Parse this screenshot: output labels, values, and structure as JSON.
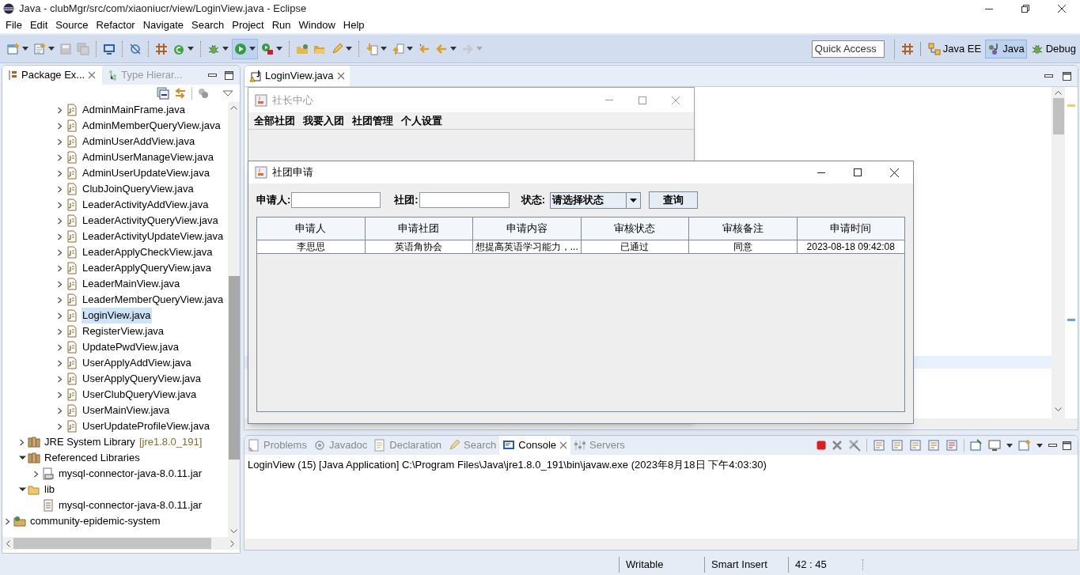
{
  "window": {
    "title": "Java - clubMgr/src/com/xiaoniucr/view/LoginView.java - Eclipse"
  },
  "menu": [
    "File",
    "Edit",
    "Source",
    "Refactor",
    "Navigate",
    "Search",
    "Project",
    "Run",
    "Window",
    "Help"
  ],
  "quick_access": {
    "placeholder": "Quick Access"
  },
  "perspectives": [
    {
      "label": "Java EE",
      "selected": false
    },
    {
      "label": "Java",
      "selected": true
    },
    {
      "label": "Debug",
      "selected": false
    }
  ],
  "package_explorer": {
    "tabs": [
      {
        "label": "Package Ex...",
        "selected": true
      },
      {
        "label": "Type Hierar...",
        "selected": false
      }
    ],
    "files": [
      {
        "label": "AdminMainFrame.java",
        "selected": false
      },
      {
        "label": "AdminMemberQueryView.java",
        "selected": false
      },
      {
        "label": "AdminUserAddView.java",
        "selected": false
      },
      {
        "label": "AdminUserManageView.java",
        "selected": false
      },
      {
        "label": "AdminUserUpdateView.java",
        "selected": false
      },
      {
        "label": "ClubJoinQueryView.java",
        "selected": false
      },
      {
        "label": "LeaderActivityAddView.java",
        "selected": false
      },
      {
        "label": "LeaderActivityQueryView.java",
        "selected": false
      },
      {
        "label": "LeaderActivityUpdateView.java",
        "selected": false
      },
      {
        "label": "LeaderApplyCheckView.java",
        "selected": false
      },
      {
        "label": "LeaderApplyQueryView.java",
        "selected": false
      },
      {
        "label": "LeaderMainView.java",
        "selected": false
      },
      {
        "label": "LeaderMemberQueryView.java",
        "selected": false
      },
      {
        "label": "LoginView.java",
        "selected": true
      },
      {
        "label": "RegisterView.java",
        "selected": false
      },
      {
        "label": "UpdatePwdView.java",
        "selected": false
      },
      {
        "label": "UserApplyAddView.java",
        "selected": false
      },
      {
        "label": "UserApplyQueryView.java",
        "selected": false
      },
      {
        "label": "UserClubQueryView.java",
        "selected": false
      },
      {
        "label": "UserMainView.java",
        "selected": false
      },
      {
        "label": "UserUpdateProfileView.java",
        "selected": false
      }
    ],
    "project_items": [
      {
        "kind": "library",
        "label": "JRE System Library",
        "suffix": "[jre1.8.0_191]",
        "expanded": false
      },
      {
        "kind": "library",
        "label": "Referenced Libraries",
        "expanded": true,
        "children": [
          {
            "kind": "jar",
            "label": "mysql-connector-java-8.0.11.jar",
            "expanded": false
          }
        ]
      },
      {
        "kind": "folder",
        "label": "lib",
        "expanded": true,
        "children": [
          {
            "kind": "jarfile",
            "label": "mysql-connector-java-8.0.11.jar"
          }
        ]
      }
    ],
    "projects": [
      {
        "label": "community-epidemic-system",
        "expanded": false
      }
    ]
  },
  "editor": {
    "tabs": [
      {
        "label": "LoginView.java",
        "selected": true
      }
    ]
  },
  "leader_window": {
    "title": "社长中心",
    "menu": [
      "全部社团",
      "我要入团",
      "社团管理",
      "个人设置"
    ]
  },
  "apply_window": {
    "title": "社团申请",
    "applicant_label": "申请人:",
    "club_label": "社团:",
    "status_label": "状态:",
    "status_value": "请选择状态",
    "query_button": "查询",
    "table": {
      "columns": [
        "申请人",
        "申请社团",
        "申请内容",
        "审核状态",
        "审核备注",
        "申请时间"
      ],
      "rows": [
        [
          "李思思",
          "英语角协会",
          "想提高英语学习能力，...",
          "已通过",
          "同意",
          "2023-08-18 09:42:08"
        ]
      ]
    }
  },
  "bottom_views": {
    "tabs": [
      {
        "label": "Problems",
        "selected": false
      },
      {
        "label": "Javadoc",
        "selected": false
      },
      {
        "label": "Declaration",
        "selected": false
      },
      {
        "label": "Search",
        "selected": false
      },
      {
        "label": "Console",
        "selected": true
      },
      {
        "label": "Servers",
        "selected": false
      }
    ],
    "console_line": "LoginView (15) [Java Application] C:\\Program Files\\Java\\jre1.8.0_191\\bin\\javaw.exe (2023年8月18日 下午4:03:30)"
  },
  "status_bar": [
    "Writable",
    "Smart Insert",
    "42 : 45"
  ]
}
